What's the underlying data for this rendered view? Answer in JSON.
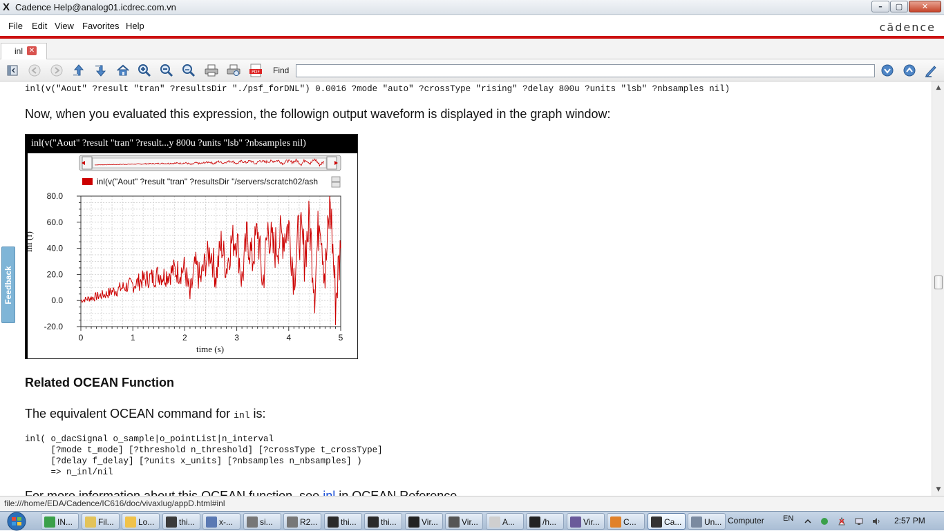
{
  "window": {
    "title": "Cadence Help@analog01.icdrec.com.vn",
    "app_glyph": "X",
    "min_label": "–",
    "max_label": "▢",
    "close_label": "✕"
  },
  "menu": [
    "File",
    "Edit",
    "View",
    "Favorites",
    "Help"
  ],
  "brand": "cādence",
  "tab": {
    "label": "inl",
    "close_glyph": "✕"
  },
  "toolbar": {
    "icons": [
      "sidebar-toggle-icon",
      "back-icon",
      "forward-icon",
      "up-icon",
      "down-icon",
      "home-icon",
      "zoom-in-icon",
      "zoom-out-icon",
      "zoom-reset-icon",
      "print-icon",
      "print-preview-icon",
      "pdf-icon",
      "find-next-icon",
      "find-prev-icon",
      "highlight-icon"
    ],
    "find_label": "Find",
    "find_value": ""
  },
  "content": {
    "code_line": "inl(v(\"Aout\" ?result \"tran\" ?resultsDir \"./psf_forDNL\") 0.0016 ?mode \"auto\" ?crossType \"rising\" ?delay 800u ?units \"lsb\" ?nbsamples nil)",
    "intro": "Now, when you evaluated this expression, the followign output waveform is displayed in the graph window:",
    "related_title": "Related OCEAN Function",
    "equiv_prefix": "The equivalent OCEAN command for ",
    "equiv_code": "inl",
    "equiv_suffix": " is:",
    "syntax": "inl( o_dacSignal o_sample|o_pointList|n_interval\n     [?mode t_mode] [?threshold n_threshold] [?crossType t_crossType]\n     [?delay f_delay] [?units x_units] [?nbsamples n_nbsamples] )\n     => n_inl/nil",
    "more_prefix": "For more information about this OCEAN function, see ",
    "more_link": "inl",
    "more_suffix": " in OCEAN Reference."
  },
  "feedback_label": "Feedback",
  "status_url": "file:///home/EDA/Cadence/IC616/doc/vivaxlug/appD.html#inl",
  "chart_data": {
    "type": "line",
    "title": "inl(v(\"Aout\" ?result \"tran\" ?result...y 800u ?units \"lsb\" ?nbsamples nil)",
    "legend": "inl(v(\"Aout\" ?result \"tran\" ?resultsDir \"/servers/scratch02/ash",
    "xlabel": "time (s)",
    "ylabel": "inl (f)",
    "xlim": [
      0,
      5
    ],
    "ylim": [
      -20,
      80
    ],
    "xticks": [
      "0",
      "1",
      "2",
      "3",
      "4",
      "5"
    ],
    "yticks": [
      "80.0",
      "60.0",
      "40.0",
      "20.0",
      "0.0",
      "-20.0"
    ],
    "grid": true,
    "series": [
      {
        "color": "#cc0000",
        "x": [
          0.0,
          0.1,
          0.2,
          0.3,
          0.4,
          0.5,
          0.6,
          0.7,
          0.8,
          0.9,
          1.0,
          1.1,
          1.2,
          1.3,
          1.4,
          1.5,
          1.6,
          1.7,
          1.8,
          1.9,
          2.0,
          2.1,
          2.2,
          2.3,
          2.4,
          2.5,
          2.6,
          2.7,
          2.8,
          2.9,
          3.0,
          3.1,
          3.2,
          3.3,
          3.4,
          3.5,
          3.6,
          3.7,
          3.8,
          3.9,
          4.0,
          4.1,
          4.2,
          4.3,
          4.4,
          4.5,
          4.6,
          4.7,
          4.8,
          4.9,
          5.0
        ],
        "y": [
          0,
          1,
          2,
          3,
          4,
          5,
          7,
          8,
          10,
          11,
          12,
          14,
          16,
          17,
          18,
          20,
          19,
          21,
          23,
          22,
          25,
          2,
          27,
          15,
          30,
          38,
          18,
          44,
          25,
          45,
          48,
          15,
          50,
          30,
          55,
          12,
          56,
          38,
          45,
          50,
          58,
          20,
          54,
          35,
          60,
          10,
          72,
          18,
          76,
          0,
          40
        ]
      }
    ]
  },
  "taskbar": {
    "tasks": [
      {
        "label": "IN...",
        "color": "#3aa04a"
      },
      {
        "label": "Fil...",
        "color": "#e3c35a"
      },
      {
        "label": "Lo...",
        "color": "#f0c24a"
      },
      {
        "label": "thi...",
        "color": "#3b3b3b"
      },
      {
        "label": "x-...",
        "color": "#5a79b3"
      },
      {
        "label": "si...",
        "color": "#777777"
      },
      {
        "label": "R2...",
        "color": "#777777"
      },
      {
        "label": "thi...",
        "color": "#2a2a2a"
      },
      {
        "label": "thi...",
        "color": "#2a2a2a"
      },
      {
        "label": "Vir...",
        "color": "#222222"
      },
      {
        "label": "Vir...",
        "color": "#555555"
      },
      {
        "label": "A...",
        "color": "#cfcfcf"
      },
      {
        "label": "/h...",
        "color": "#222222"
      },
      {
        "label": "Vir...",
        "color": "#6a5a9a"
      },
      {
        "label": "C...",
        "color": "#e0812a"
      },
      {
        "label": "Ca...",
        "color": "#333333"
      },
      {
        "label": "Un...",
        "color": "#7a8aa0"
      }
    ],
    "computer": "Computer",
    "lang": "EN",
    "clock": "2:57 PM"
  }
}
